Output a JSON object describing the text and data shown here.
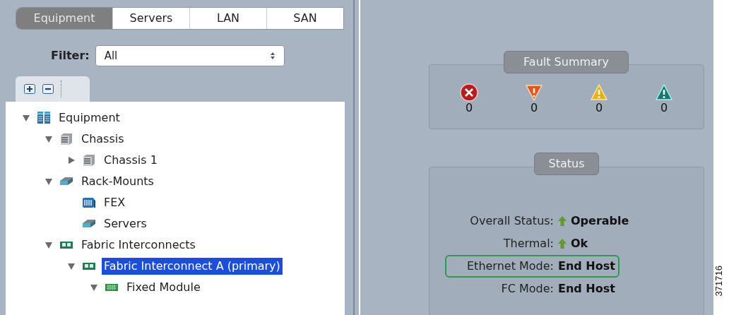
{
  "tabs": [
    {
      "label": "Equipment",
      "selected": true
    },
    {
      "label": "Servers",
      "selected": false
    },
    {
      "label": "LAN",
      "selected": false
    },
    {
      "label": "SAN",
      "selected": false
    }
  ],
  "filter": {
    "label": "Filter:",
    "value": "All"
  },
  "tree": [
    {
      "label": "Equipment",
      "kind": "root",
      "expanded": true,
      "selected": false,
      "children": [
        {
          "label": "Chassis",
          "kind": "chassis",
          "expanded": true,
          "selected": false,
          "children": [
            {
              "label": "Chassis 1",
              "kind": "chassis",
              "expanded": false,
              "selected": false
            }
          ]
        },
        {
          "label": "Rack-Mounts",
          "kind": "rack",
          "expanded": true,
          "selected": false,
          "children": [
            {
              "label": "FEX",
              "kind": "fex",
              "selected": false
            },
            {
              "label": "Servers",
              "kind": "rack",
              "selected": false
            }
          ]
        },
        {
          "label": "Fabric Interconnects",
          "kind": "fabric",
          "expanded": true,
          "selected": false,
          "children": [
            {
              "label": "Fabric Interconnect A (primary)",
              "kind": "fabric",
              "expanded": true,
              "selected": true,
              "children": [
                {
                  "label": "Fixed Module",
                  "kind": "module",
                  "expanded": true,
                  "selected": false
                }
              ]
            }
          ]
        }
      ]
    }
  ],
  "fault_summary": {
    "title": "Fault Summary",
    "faults": [
      {
        "kind": "critical",
        "count": "0"
      },
      {
        "kind": "major",
        "count": "0"
      },
      {
        "kind": "minor",
        "count": "0"
      },
      {
        "kind": "warning",
        "count": "0"
      }
    ]
  },
  "status": {
    "title": "Status",
    "rows": [
      {
        "label": "Overall Status:",
        "value": "Operable",
        "up": true,
        "highlighted": false
      },
      {
        "label": "Thermal:",
        "value": "Ok",
        "up": true,
        "highlighted": false
      },
      {
        "label": "Ethernet Mode:",
        "value": "End Host",
        "up": false,
        "highlighted": true
      },
      {
        "label": "FC Mode:",
        "value": "End Host",
        "up": false,
        "highlighted": false
      }
    ]
  },
  "figure_number": "371716"
}
